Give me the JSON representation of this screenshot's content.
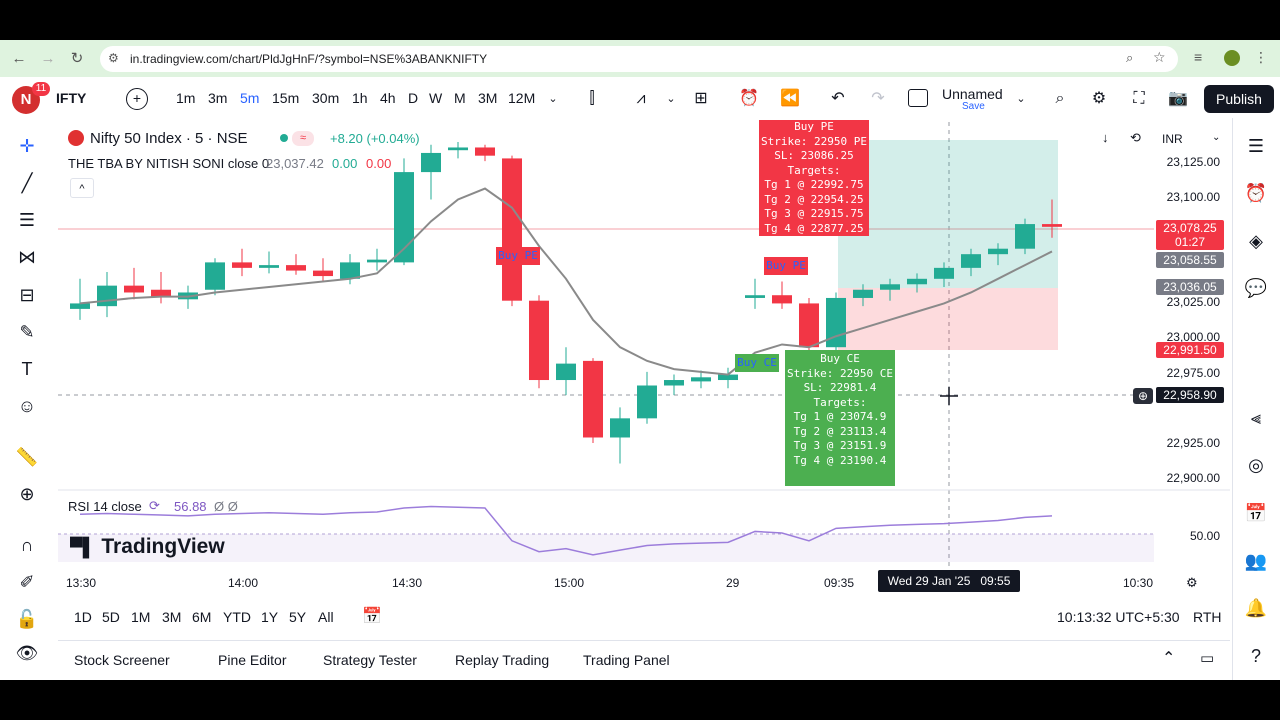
{
  "browser": {
    "url": "in.tradingview.com/chart/PldJgHnF/?symbol=NSE%3ABANKNIFTY"
  },
  "topbar": {
    "notif_count": "11",
    "avatar_letter": "N",
    "symbol": "IFTY",
    "intervals": [
      "1m",
      "3m",
      "5m",
      "15m",
      "30m",
      "1h",
      "4h",
      "D",
      "W",
      "M",
      "3M",
      "12M"
    ],
    "active_interval": "5m",
    "layout_name": "Unnamed",
    "layout_status": "Save",
    "publish_label": "Publish"
  },
  "legend": {
    "instrument": "Nifty 50 Index · 5 · NSE",
    "change": "+8.20 (+0.04%)",
    "indicator_name": "THE TBA BY NITISH SONI close 0",
    "indicator_v1": "23,037.42",
    "indicator_v2": "0.00",
    "indicator_v3": "0.00",
    "rsi_label": "RSI 14 close",
    "rsi_value": "56.88",
    "rsi_extra": "Ø Ø"
  },
  "currency": "INR",
  "price_axis": {
    "ticks": [
      "23,125.00",
      "23,100.00",
      "23,025.00",
      "23,000.00",
      "22,975.00",
      "22,925.00",
      "22,900.00"
    ],
    "badges": {
      "last_price": "23,078.25",
      "last_countdown": "01:27",
      "badge_a": "23,058.55",
      "badge_b": "23,036.05",
      "badge_sl": "22,991.50",
      "crosshair": "22,958.90"
    },
    "rsi_tick": "50.00"
  },
  "time_axis": {
    "ticks": [
      "13:30",
      "14:00",
      "14:30",
      "15:00",
      "29",
      "09:35",
      "10:30"
    ],
    "crosshair_label": "Wed 29 Jan '25   09:55"
  },
  "signals": {
    "buy_pe_small": "Buy PE",
    "buy_pe_small2": "Buy PE",
    "buy_ce_small": "Buy CE",
    "pe_box": [
      "Buy PE",
      "Strike: 22950 PE",
      "SL: 23086.25",
      "Targets:",
      "Tg 1 @ 22992.75",
      "Tg 2 @ 22954.25",
      "Tg 3 @ 22915.75",
      "Tg 4 @ 22877.25"
    ],
    "ce_box": [
      "Buy CE",
      "Strike: 22950 CE",
      "SL: 22981.4",
      "Targets:",
      "Tg 1 @ 23074.9",
      "Tg 2 @ 23113.4",
      "Tg 3 @ 23151.9",
      "Tg 4 @ 23190.4"
    ]
  },
  "watermark": "TradingView",
  "range": {
    "buttons": [
      "1D",
      "5D",
      "1M",
      "3M",
      "6M",
      "YTD",
      "1Y",
      "5Y",
      "All"
    ],
    "clock": "10:13:32 UTC+5:30",
    "session": "RTH"
  },
  "bottom_panel": {
    "tabs": [
      "Stock Screener",
      "Pine Editor",
      "Strategy Tester",
      "Replay Trading",
      "Trading Panel"
    ]
  },
  "colors": {
    "up": "#22ab94",
    "down": "#f23645",
    "ma": "#8a8a8a",
    "rsi": "#9c7ddb",
    "accent": "#2962ff"
  },
  "chart_data": {
    "type": "candlestick",
    "candles": [
      {
        "o": 23018,
        "h": 23040,
        "l": 23010,
        "c": 23022
      },
      {
        "o": 23020,
        "h": 23045,
        "l": 23012,
        "c": 23035
      },
      {
        "o": 23035,
        "h": 23048,
        "l": 23025,
        "c": 23030
      },
      {
        "o": 23032,
        "h": 23045,
        "l": 23022,
        "c": 23027
      },
      {
        "o": 23025,
        "h": 23035,
        "l": 23018,
        "c": 23030
      },
      {
        "o": 23032,
        "h": 23055,
        "l": 23028,
        "c": 23052
      },
      {
        "o": 23052,
        "h": 23062,
        "l": 23042,
        "c": 23048
      },
      {
        "o": 23048,
        "h": 23060,
        "l": 23044,
        "c": 23050
      },
      {
        "o": 23050,
        "h": 23058,
        "l": 23043,
        "c": 23046
      },
      {
        "o": 23046,
        "h": 23055,
        "l": 23038,
        "c": 23042
      },
      {
        "o": 23040,
        "h": 23058,
        "l": 23036,
        "c": 23052
      },
      {
        "o": 23052,
        "h": 23062,
        "l": 23046,
        "c": 23054
      },
      {
        "o": 23052,
        "h": 23128,
        "l": 23050,
        "c": 23118
      },
      {
        "o": 23118,
        "h": 23138,
        "l": 23098,
        "c": 23132
      },
      {
        "o": 23134,
        "h": 23140,
        "l": 23128,
        "c": 23136
      },
      {
        "o": 23136,
        "h": 23138,
        "l": 23126,
        "c": 23130
      },
      {
        "o": 23128,
        "h": 23130,
        "l": 23020,
        "c": 23024
      },
      {
        "o": 23024,
        "h": 23028,
        "l": 22960,
        "c": 22966
      },
      {
        "o": 22966,
        "h": 22990,
        "l": 22955,
        "c": 22978
      },
      {
        "o": 22980,
        "h": 22982,
        "l": 22920,
        "c": 22924
      },
      {
        "o": 22924,
        "h": 22946,
        "l": 22905,
        "c": 22938
      },
      {
        "o": 22938,
        "h": 22972,
        "l": 22934,
        "c": 22962
      },
      {
        "o": 22962,
        "h": 22970,
        "l": 22955,
        "c": 22966
      },
      {
        "o": 22965,
        "h": 22973,
        "l": 22960,
        "c": 22968
      },
      {
        "o": 22966,
        "h": 22975,
        "l": 22960,
        "c": 22970
      },
      {
        "o": 23026,
        "h": 23040,
        "l": 23018,
        "c": 23028
      },
      {
        "o": 23028,
        "h": 23038,
        "l": 23018,
        "c": 23022
      },
      {
        "o": 23022,
        "h": 23026,
        "l": 22985,
        "c": 22990
      },
      {
        "o": 22990,
        "h": 23030,
        "l": 22985,
        "c": 23026
      },
      {
        "o": 23026,
        "h": 23036,
        "l": 23020,
        "c": 23032
      },
      {
        "o": 23032,
        "h": 23040,
        "l": 23024,
        "c": 23036
      },
      {
        "o": 23036,
        "h": 23044,
        "l": 23030,
        "c": 23040
      },
      {
        "o": 23040,
        "h": 23052,
        "l": 23034,
        "c": 23048
      },
      {
        "o": 23048,
        "h": 23062,
        "l": 23042,
        "c": 23058
      },
      {
        "o": 23058,
        "h": 23066,
        "l": 23050,
        "c": 23062
      },
      {
        "o": 23062,
        "h": 23084,
        "l": 23058,
        "c": 23080
      },
      {
        "o": 23080,
        "h": 23098,
        "l": 23070,
        "c": 23078
      }
    ],
    "ma_line": [
      23022,
      23024,
      23026,
      23027,
      23027,
      23030,
      23032,
      23034,
      23036,
      23038,
      23040,
      23044,
      23062,
      23082,
      23098,
      23106,
      23092,
      23064,
      23040,
      23010,
      22990,
      22980,
      22974,
      22972,
      22970,
      22986,
      22992,
      22990,
      22998,
      23004,
      23010,
      23016,
      23022,
      23030,
      23040,
      23050,
      23060
    ],
    "rsi": [
      74,
      75,
      74,
      73,
      72,
      74,
      75,
      76,
      75,
      74,
      76,
      77,
      82,
      84,
      83,
      82,
      40,
      26,
      30,
      22,
      28,
      34,
      36,
      37,
      38,
      52,
      50,
      40,
      56,
      58,
      60,
      61,
      62,
      64,
      66,
      70,
      72
    ],
    "rsi_range": [
      0,
      100
    ],
    "y_range": [
      22890,
      23140
    ]
  }
}
